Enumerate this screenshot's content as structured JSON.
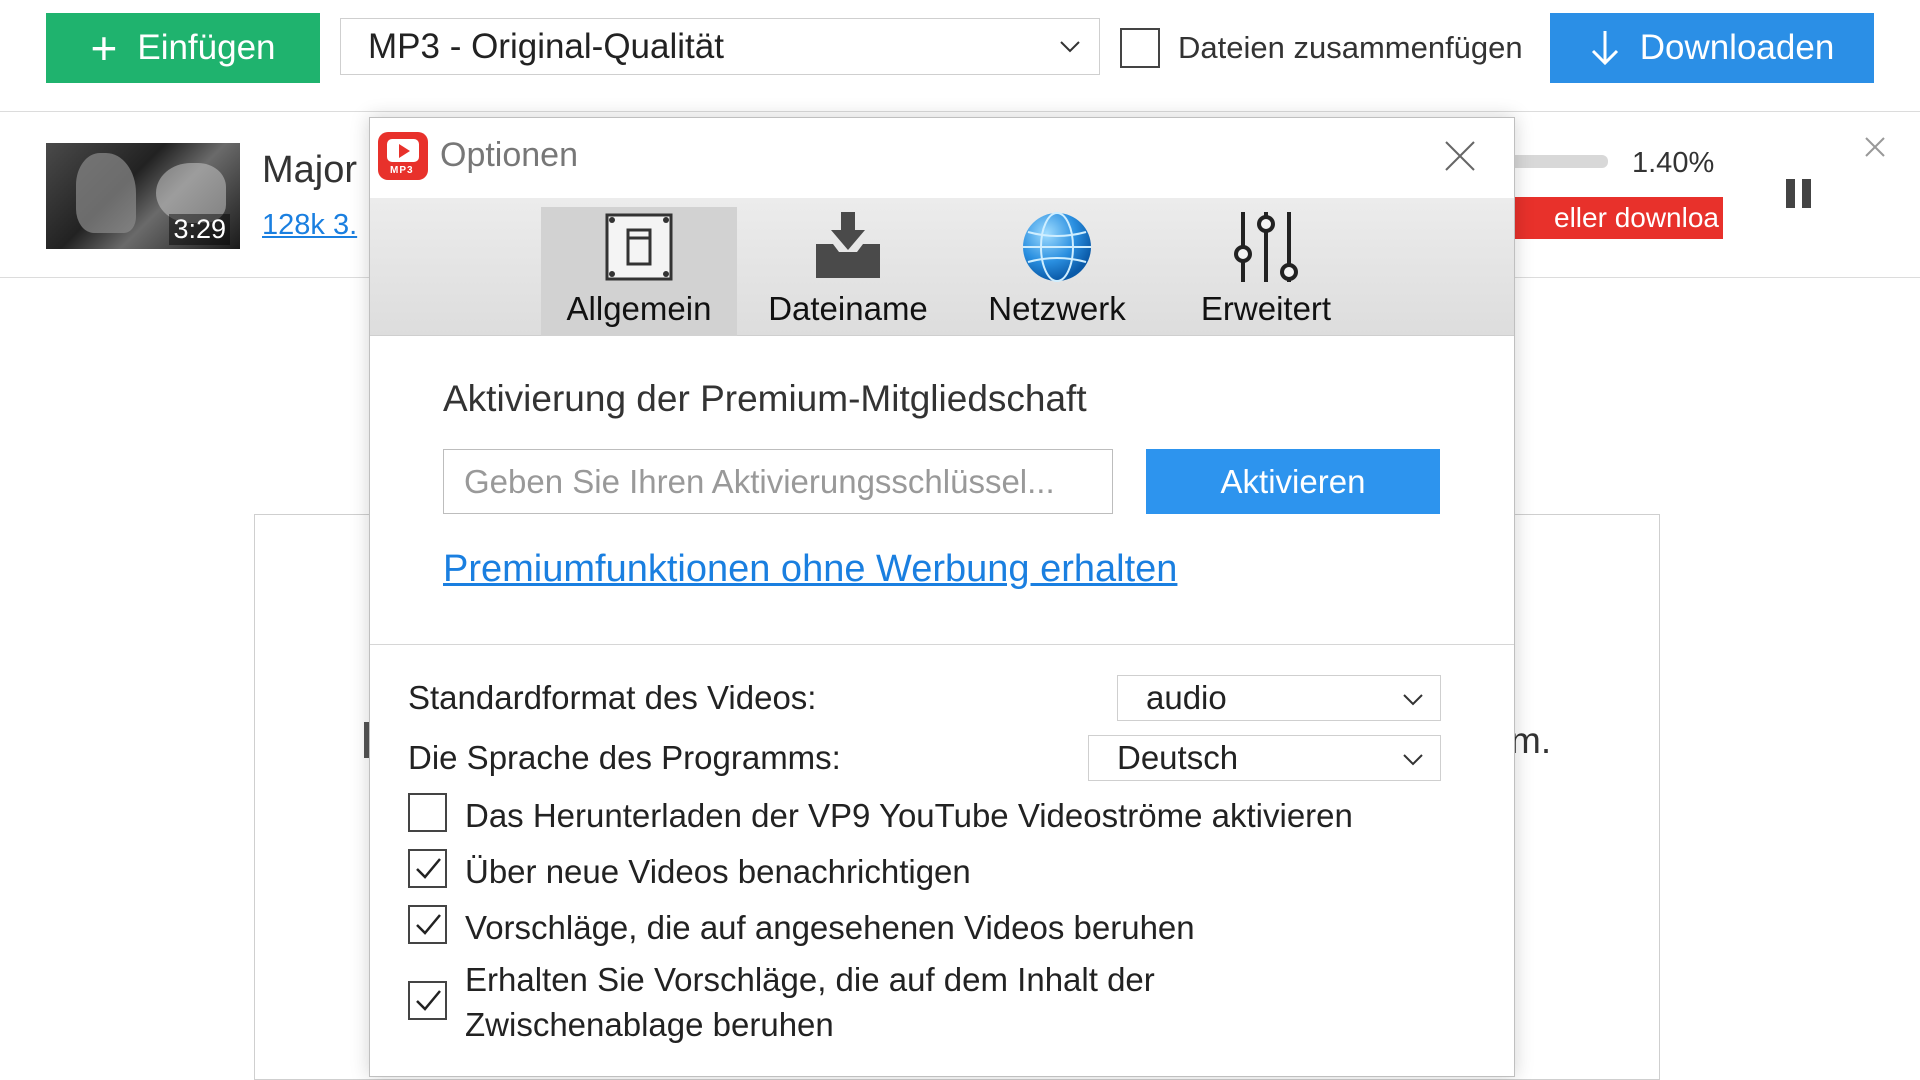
{
  "toolbar": {
    "paste_label": "Einfügen",
    "format_value": "MP3 - Original-Qualität",
    "merge_label": "Dateien zusammenfügen",
    "merge_checked": false,
    "download_label": "Downloaden"
  },
  "item": {
    "title": "Major",
    "duration": "3:29",
    "quality": "128k 3.",
    "progress_percent": "1.40%",
    "progress_value": 1.4,
    "faster_label": "eller downloa"
  },
  "background": {
    "text_fragment": "m."
  },
  "dialog": {
    "title": "Optionen",
    "tabs": [
      {
        "label": "Allgemein",
        "icon": "general-settings-icon",
        "active": true
      },
      {
        "label": "Dateiname",
        "icon": "file-download-icon",
        "active": false
      },
      {
        "label": "Netzwerk",
        "icon": "globe-icon",
        "active": false
      },
      {
        "label": "Erweitert",
        "icon": "sliders-icon",
        "active": false
      }
    ],
    "premium": {
      "heading": "Aktivierung der Premium-Mitgliedschaft",
      "key_placeholder": "Geben Sie Ihren Aktivierungsschlüssel...",
      "activate_label": "Aktivieren",
      "link_label": "Premiumfunktionen ohne Werbung erhalten"
    },
    "options": {
      "video_format_label": "Standardformat des Videos:",
      "video_format_value": "audio",
      "language_label": "Die Sprache des Programms:",
      "language_value": "Deutsch",
      "checkboxes": [
        {
          "label": "Das Herunterladen der VP9 YouTube Videoströme aktivieren",
          "checked": false
        },
        {
          "label": "Über neue Videos benachrichtigen",
          "checked": true
        },
        {
          "label": "Vorschläge, die auf angesehenen Videos beruhen",
          "checked": true
        },
        {
          "label": "Erhalten Sie Vorschläge, die auf dem Inhalt der Zwischenablage beruhen",
          "checked": true
        }
      ]
    }
  },
  "colors": {
    "paste_green": "#1fb36e",
    "download_blue": "#2b8fe6",
    "activate_blue": "#2d94ee",
    "link_blue": "#1a7fe0",
    "accent_red": "#e8312b"
  }
}
